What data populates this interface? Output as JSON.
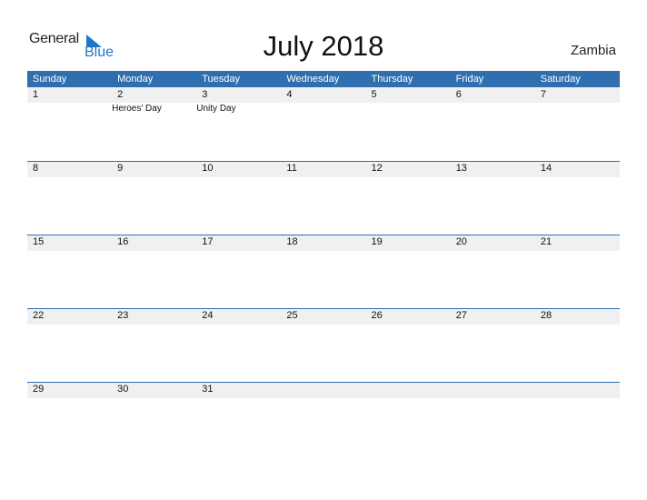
{
  "logo": {
    "general": "General",
    "blue": "Blue",
    "brand_color": "#1f77c7"
  },
  "title": "July 2018",
  "country": "Zambia",
  "header_color": "#2f6fb0",
  "weekdays": [
    "Sunday",
    "Monday",
    "Tuesday",
    "Wednesday",
    "Thursday",
    "Friday",
    "Saturday"
  ],
  "weeks": [
    [
      {
        "day": "1"
      },
      {
        "day": "2",
        "event": "Heroes' Day"
      },
      {
        "day": "3",
        "event": "Unity Day"
      },
      {
        "day": "4"
      },
      {
        "day": "5"
      },
      {
        "day": "6"
      },
      {
        "day": "7"
      }
    ],
    [
      {
        "day": "8"
      },
      {
        "day": "9"
      },
      {
        "day": "10"
      },
      {
        "day": "11"
      },
      {
        "day": "12"
      },
      {
        "day": "13"
      },
      {
        "day": "14"
      }
    ],
    [
      {
        "day": "15"
      },
      {
        "day": "16"
      },
      {
        "day": "17"
      },
      {
        "day": "18"
      },
      {
        "day": "19"
      },
      {
        "day": "20"
      },
      {
        "day": "21"
      }
    ],
    [
      {
        "day": "22"
      },
      {
        "day": "23"
      },
      {
        "day": "24"
      },
      {
        "day": "25"
      },
      {
        "day": "26"
      },
      {
        "day": "27"
      },
      {
        "day": "28"
      }
    ],
    [
      {
        "day": "29"
      },
      {
        "day": "30"
      },
      {
        "day": "31"
      },
      {
        "day": ""
      },
      {
        "day": ""
      },
      {
        "day": ""
      },
      {
        "day": ""
      }
    ]
  ]
}
